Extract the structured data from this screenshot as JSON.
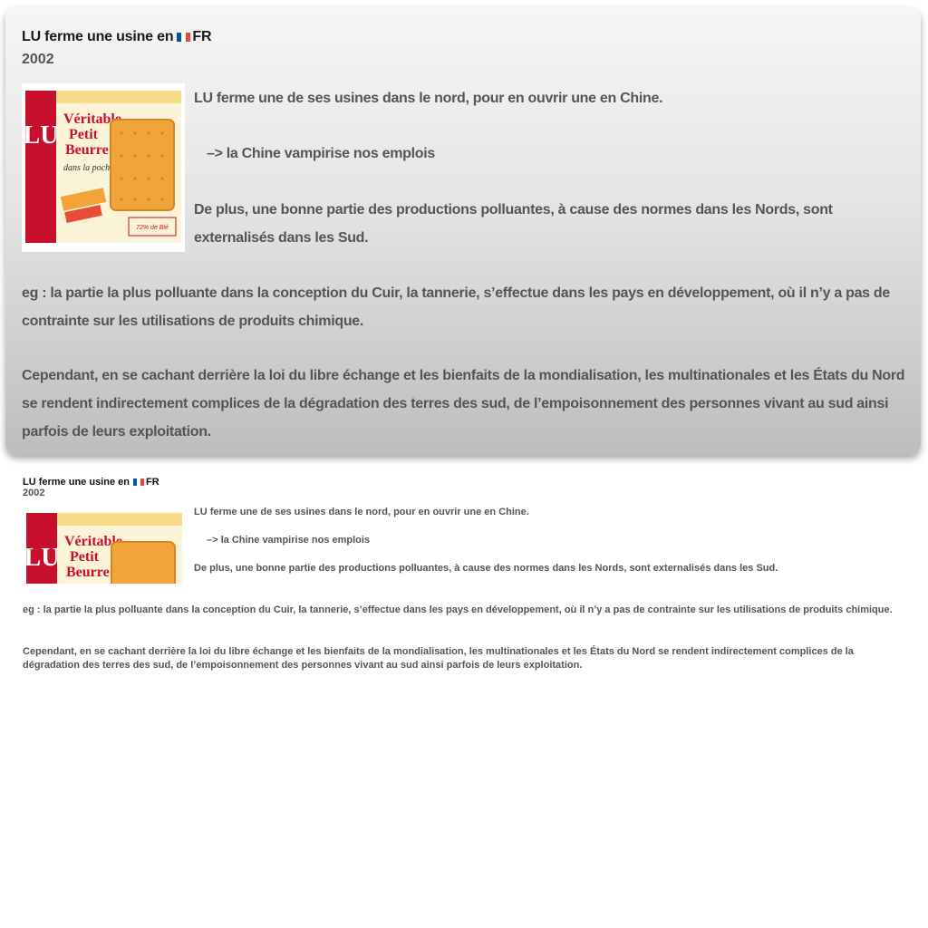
{
  "post": {
    "title": "LU ferme une usine en",
    "flag_icon": "france-flag-icon",
    "flag_code": "FR",
    "year": "2002",
    "image_logo": "LU",
    "image_text_1": "Véritable",
    "image_text_2": "Petit",
    "image_text_3": "Beurre",
    "image_text_4": "dans la poche",
    "image_badge": "72% de Blé",
    "paragraph_1": "LU ferme une de ses usines dans le nord, pour en ouvrir une en Chine.",
    "paragraph_2": "–> la Chine vampirise nos emplois",
    "paragraph_3": "De plus, une bonne partie des productions polluantes, à cause des normes dans les Nords, sont externalisés dans les Sud.",
    "paragraph_4": "eg : la partie la plus polluante dans la conception du Cuir, la tannerie, s’effectue dans les pays en développement, où il n’y a pas de contrainte sur les utilisations de produits chimique.",
    "paragraph_5": "Cependant, en se cachant derrière la loi du libre échange et les bienfaits de la mondialisation, les multinationales et les États du Nord se rendent indirectement complices de la dégradation des terres des sud, de l’empoisonnement des personnes vivant au sud ainsi parfois de leurs exploitation."
  },
  "colors": {
    "flag_blue": "#0055a4",
    "flag_white": "#ffffff",
    "flag_red": "#ef4135",
    "lu_red": "#c8102e",
    "biscuit": "#f2a33a"
  }
}
